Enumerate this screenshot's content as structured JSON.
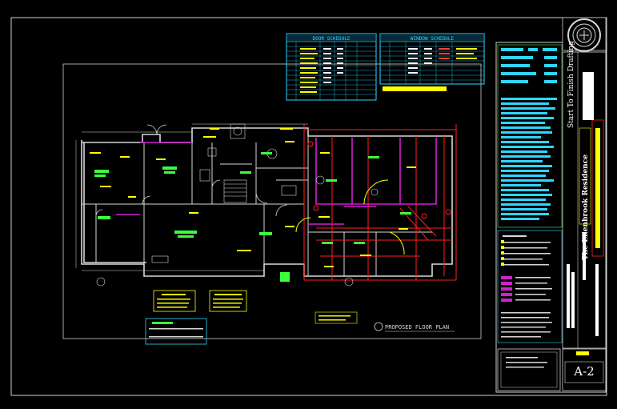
{
  "sheet": {
    "colors": {
      "background": "#000000",
      "border": "#d8d8d8",
      "walls": "#d8d8d8",
      "cyan": "#2fd6ff",
      "yellow": "#ffff00",
      "green": "#3cff3c",
      "red": "#ff2020",
      "magenta": "#d020d0",
      "white": "#ffffff"
    }
  },
  "schedules": {
    "door_title": "DOOR SCHEDULE",
    "window_title": "WINDOW SCHEDULE"
  },
  "plan": {
    "title": "PROPOSED FLOOR PLAN"
  },
  "title_block": {
    "company": "Start To Finish Drafting",
    "project": "The Ellenbrook Residence",
    "sheet_number": "A-2"
  }
}
